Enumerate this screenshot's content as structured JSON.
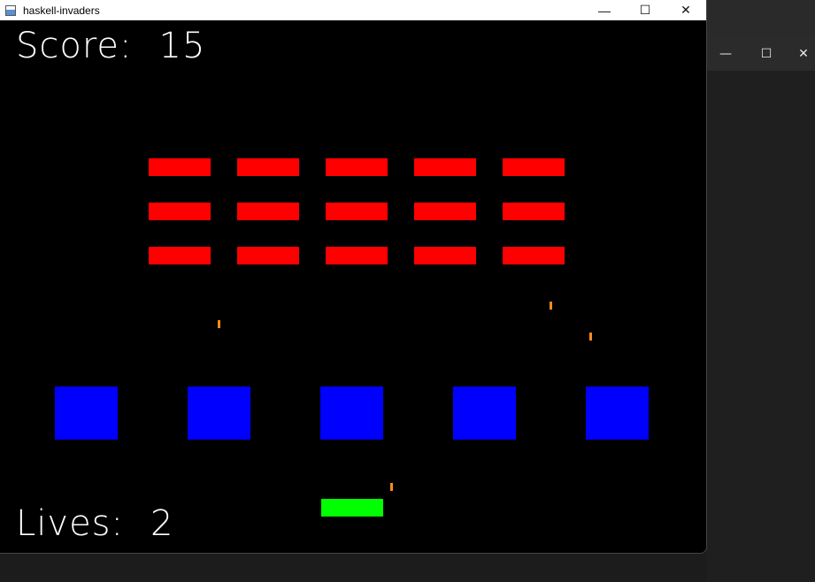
{
  "window": {
    "title": "haskell-invaders",
    "app_icon": "app-icon",
    "controls": [
      {
        "name": "minimize-button",
        "icon": "minimize-icon",
        "glyph": "—"
      },
      {
        "name": "maximize-button",
        "icon": "maximize-icon",
        "glyph": "☐"
      },
      {
        "name": "close-button",
        "icon": "close-icon",
        "glyph": "✕"
      }
    ]
  },
  "background_window": {
    "controls": [
      {
        "name": "bg-minimize-button",
        "glyph": "—"
      },
      {
        "name": "bg-maximize-button",
        "glyph": "☐"
      },
      {
        "name": "bg-close-button",
        "glyph": "✕"
      }
    ]
  },
  "hud": {
    "score_label": "Score:",
    "score_value": "15",
    "lives_label": "Lives:",
    "lives_value": "2"
  },
  "game": {
    "invader_grid": {
      "rows": 3,
      "cols": 5
    },
    "bunkers": 5,
    "enemy_bullets": 3,
    "player_bullets": 1
  },
  "colors": {
    "background": "#000000",
    "invader": "#ff0000",
    "bunker": "#0000ff",
    "player": "#00ff00",
    "bullet": "#ff8c1a",
    "text": "#ffffff"
  }
}
